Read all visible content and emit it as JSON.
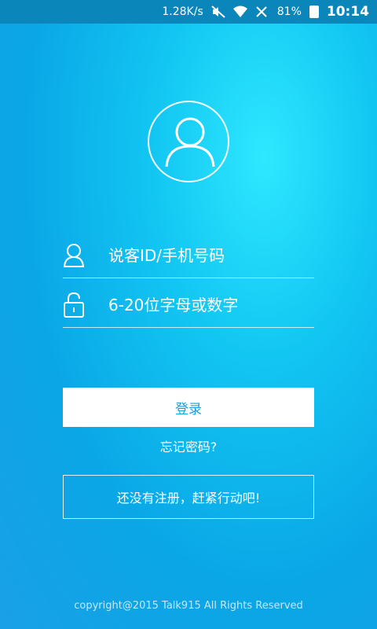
{
  "status_bar": {
    "net_speed": "1.28K/s",
    "battery": "81%",
    "time": "10:14",
    "icons": [
      "mute-icon",
      "wifi-icon",
      "no-signal-icon",
      "battery-icon"
    ]
  },
  "avatar": {
    "icon": "user-avatar-icon"
  },
  "account": {
    "placeholder": "说客ID/手机号码",
    "icon": "user-icon"
  },
  "password": {
    "placeholder": "6-20位字母或数字",
    "icon": "lock-icon"
  },
  "login": {
    "label": "登录",
    "color": "#1a9fd9"
  },
  "forgot": {
    "label": "忘记密码?"
  },
  "register": {
    "label": "还没有注册，赶紧行动吧!"
  },
  "footer": {
    "copyright": "copyright@2015 Talk915 All Rights Reserved"
  },
  "colors": {
    "status_bar": "#0b86ba",
    "background": "#12c6f2"
  }
}
